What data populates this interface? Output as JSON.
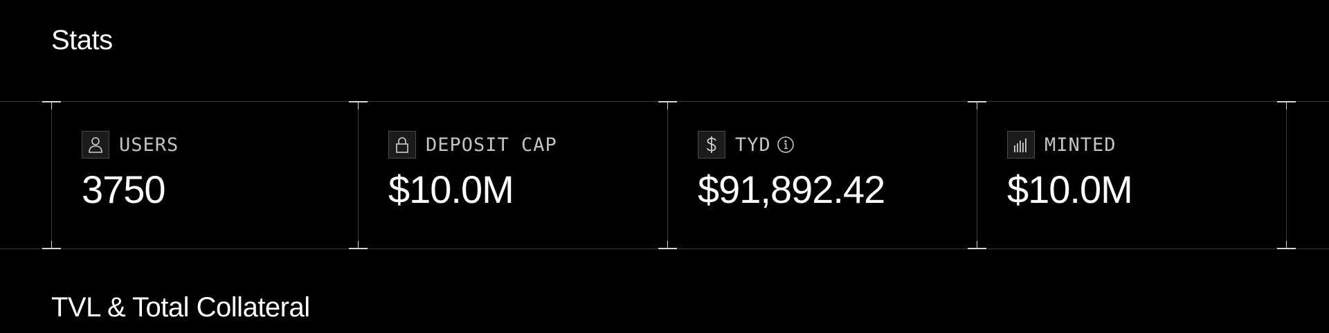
{
  "sections": {
    "stats_title": "Stats",
    "tvl_title": "TVL & Total Collateral"
  },
  "stats": [
    {
      "icon": "user-icon",
      "label": "USERS",
      "value": "3750"
    },
    {
      "icon": "lock-icon",
      "label": "DEPOSIT CAP",
      "value": "$10.0M"
    },
    {
      "icon": "dollar-icon",
      "label": "TYD",
      "value": "$91,892.42",
      "info": "info-icon"
    },
    {
      "icon": "bar-chart-icon",
      "label": "MINTED",
      "value": "$10.0M"
    }
  ],
  "colors": {
    "background": "#000000",
    "text": "#ffffff",
    "label": "#c4c4c4",
    "border": "#3a3a3a"
  }
}
